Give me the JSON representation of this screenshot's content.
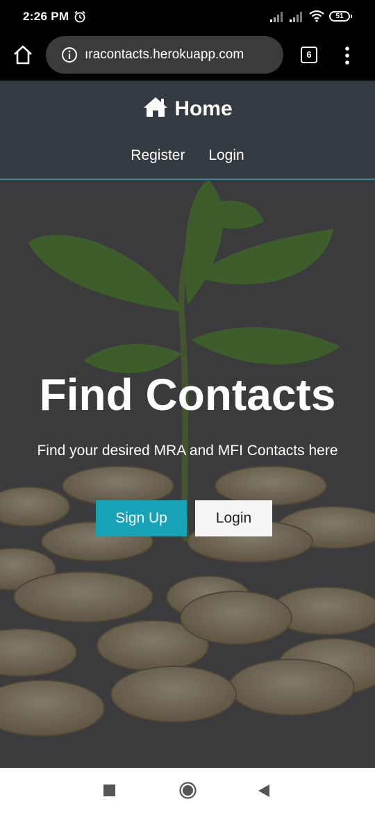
{
  "status_bar": {
    "time": "2:26 PM",
    "battery": "51",
    "icons": [
      "alarm-icon",
      "signal-icon",
      "signal-icon",
      "wifi-icon",
      "battery-icon"
    ]
  },
  "browser": {
    "url": "ıracontacts.herokuapp.com",
    "tab_count": "6",
    "icons": [
      "home-icon",
      "info-icon",
      "tabs-icon",
      "more-vert-icon"
    ]
  },
  "navbar": {
    "brand_label": "Home",
    "brand_icon": "home-icon",
    "links": [
      "Register",
      "Login"
    ],
    "background": "#343a42"
  },
  "hero": {
    "title": "Find Contacts",
    "subtitle": "Find your desired MRA and MFI Contacts here",
    "signup_label": "Sign Up",
    "login_label": "Login",
    "accent": "#17a2b8"
  },
  "system_nav": {
    "icons": [
      "recents-square-icon",
      "home-circle-icon",
      "back-triangle-icon"
    ]
  }
}
